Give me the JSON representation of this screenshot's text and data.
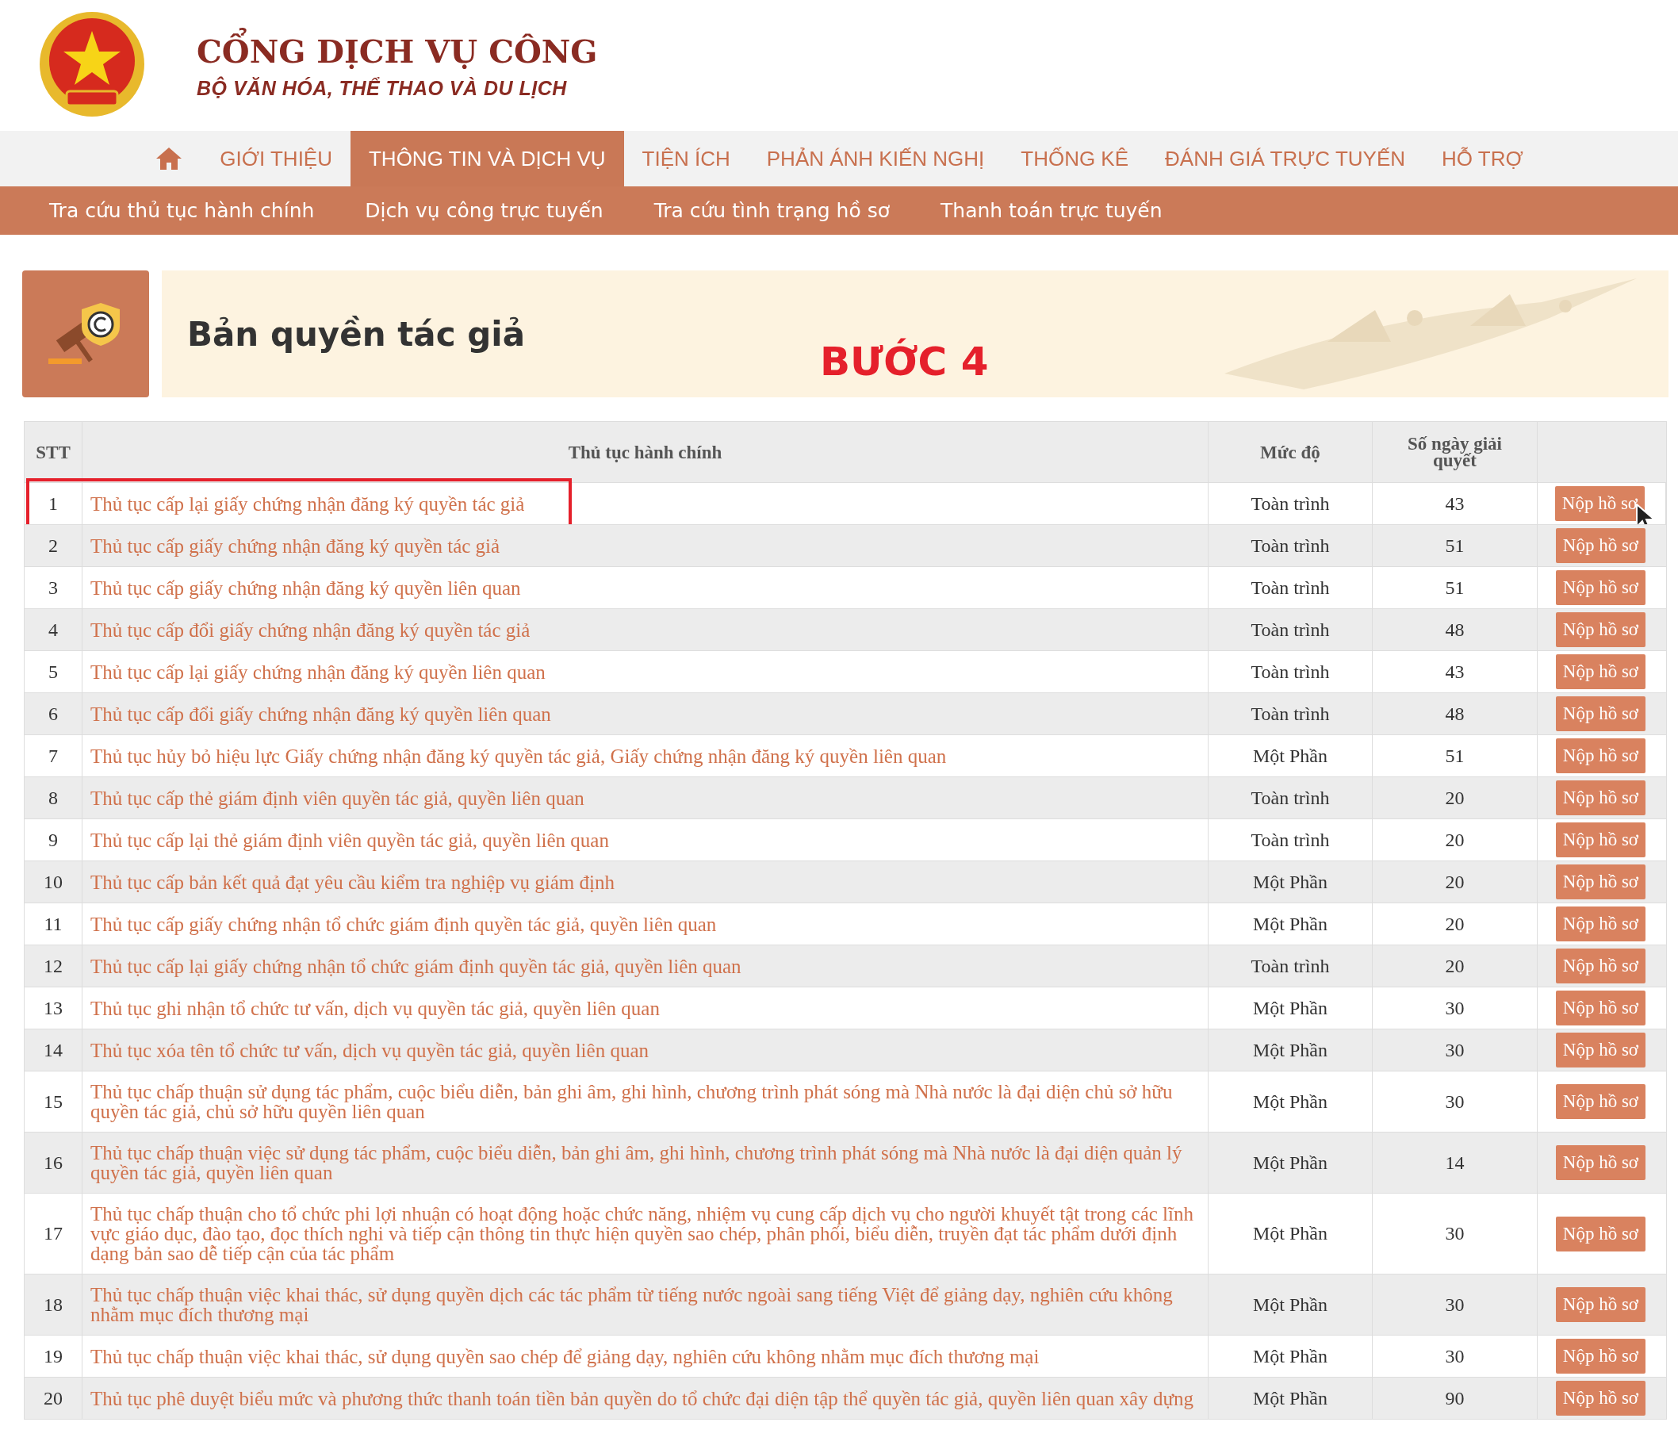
{
  "header": {
    "title": "CỔNG DỊCH VỤ CÔNG",
    "subtitle": "BỘ VĂN HÓA, THỂ THAO VÀ DU LỊCH"
  },
  "nav": [
    {
      "kind": "home",
      "selected": false
    },
    {
      "kind": "text",
      "label": "GIỚI THIỆU",
      "selected": false
    },
    {
      "kind": "text",
      "label": "THÔNG TIN VÀ DỊCH VỤ",
      "selected": true
    },
    {
      "kind": "text",
      "label": "TIỆN ÍCH",
      "selected": false
    },
    {
      "kind": "text",
      "label": "PHẢN ÁNH KIẾN NGHỊ",
      "selected": false
    },
    {
      "kind": "text",
      "label": "THỐNG KÊ",
      "selected": false
    },
    {
      "kind": "text",
      "label": "ĐÁNH GIÁ TRỰC TUYẾN",
      "selected": false
    },
    {
      "kind": "text",
      "label": "HỖ TRỢ",
      "selected": false
    }
  ],
  "subnav": [
    "Tra cứu thủ tục hành chính",
    "Dịch vụ công trực tuyến",
    "Tra cứu tình trạng hồ sơ",
    "Thanh toán trực tuyến"
  ],
  "banner": {
    "title": "Bản quyền tác giả",
    "annotation": "BƯỚC 4"
  },
  "table": {
    "columns": [
      "STT",
      "Thủ tục hành chính",
      "Mức độ",
      "Số ngày giải quyết"
    ],
    "rows": [
      {
        "stt": "1",
        "name": "Thủ tục cấp lại giấy chứng nhận đăng ký quyền tác giả",
        "level": "Toàn trình",
        "days": "43",
        "action": "Nộp hồ sơ",
        "highlighted": true,
        "hovered": true
      },
      {
        "stt": "2",
        "name": "Thủ tục cấp giấy chứng nhận đăng ký quyền tác giả",
        "level": "Toàn trình",
        "days": "51",
        "action": "Nộp hồ sơ",
        "highlighted": false,
        "hovered": false
      },
      {
        "stt": "3",
        "name": "Thủ tục cấp giấy chứng nhận đăng ký quyền liên quan",
        "level": "Toàn trình",
        "days": "51",
        "action": "Nộp hồ sơ",
        "highlighted": false,
        "hovered": false
      },
      {
        "stt": "4",
        "name": "Thủ tục cấp đổi giấy chứng nhận đăng ký quyền tác giả",
        "level": "Toàn trình",
        "days": "48",
        "action": "Nộp hồ sơ",
        "highlighted": false,
        "hovered": false
      },
      {
        "stt": "5",
        "name": "Thủ tục cấp lại giấy chứng nhận đăng ký quyền liên quan",
        "level": "Toàn trình",
        "days": "43",
        "action": "Nộp hồ sơ",
        "highlighted": false,
        "hovered": false
      },
      {
        "stt": "6",
        "name": "Thủ tục cấp đổi giấy chứng nhận đăng ký quyền liên quan",
        "level": "Toàn trình",
        "days": "48",
        "action": "Nộp hồ sơ",
        "highlighted": false,
        "hovered": false
      },
      {
        "stt": "7",
        "name": "Thủ tục hủy bỏ hiệu lực Giấy chứng nhận đăng ký quyền tác giả, Giấy chứng nhận đăng ký quyền liên quan",
        "level": "Một Phần",
        "days": "51",
        "action": "Nộp hồ sơ",
        "highlighted": false,
        "hovered": false
      },
      {
        "stt": "8",
        "name": "Thủ tục cấp thẻ giám định viên quyền tác giả, quyền liên quan",
        "level": "Toàn trình",
        "days": "20",
        "action": "Nộp hồ sơ",
        "highlighted": false,
        "hovered": false
      },
      {
        "stt": "9",
        "name": "Thủ tục cấp lại thẻ giám định viên quyền tác giả, quyền liên quan",
        "level": "Toàn trình",
        "days": "20",
        "action": "Nộp hồ sơ",
        "highlighted": false,
        "hovered": false
      },
      {
        "stt": "10",
        "name": "Thủ tục cấp bản kết quả đạt yêu cầu kiểm tra nghiệp vụ giám định",
        "level": "Một Phần",
        "days": "20",
        "action": "Nộp hồ sơ",
        "highlighted": false,
        "hovered": false
      },
      {
        "stt": "11",
        "name": "Thủ tục cấp giấy chứng nhận tổ chức giám định quyền tác giả, quyền liên quan",
        "level": "Một Phần",
        "days": "20",
        "action": "Nộp hồ sơ",
        "highlighted": false,
        "hovered": false
      },
      {
        "stt": "12",
        "name": "Thủ tục cấp lại giấy chứng nhận tổ chức giám định quyền tác giả, quyền liên quan",
        "level": "Toàn trình",
        "days": "20",
        "action": "Nộp hồ sơ",
        "highlighted": false,
        "hovered": false
      },
      {
        "stt": "13",
        "name": "Thủ tục ghi nhận tổ chức tư vấn, dịch vụ quyền tác giả, quyền liên quan",
        "level": "Một Phần",
        "days": "30",
        "action": "Nộp hồ sơ",
        "highlighted": false,
        "hovered": false
      },
      {
        "stt": "14",
        "name": "Thủ tục xóa tên tổ chức tư vấn, dịch vụ quyền tác giả, quyền liên quan",
        "level": "Một Phần",
        "days": "30",
        "action": "Nộp hồ sơ",
        "highlighted": false,
        "hovered": false
      },
      {
        "stt": "15",
        "name": "Thủ tục chấp thuận sử dụng tác phẩm, cuộc biểu diễn, bản ghi âm, ghi hình, chương trình phát sóng mà Nhà nước là đại diện chủ sở hữu quyền tác giả, chủ sở hữu quyền liên quan",
        "level": "Một Phần",
        "days": "30",
        "action": "Nộp hồ sơ",
        "highlighted": false,
        "hovered": false
      },
      {
        "stt": "16",
        "name": "Thủ tục chấp thuận việc sử dụng tác phẩm, cuộc biểu diễn, bản ghi âm, ghi hình, chương trình phát sóng mà Nhà nước là đại diện quản lý quyền tác giả, quyền liên quan",
        "level": "Một Phần",
        "days": "14",
        "action": "Nộp hồ sơ",
        "highlighted": false,
        "hovered": false
      },
      {
        "stt": "17",
        "name": "Thủ tục chấp thuận cho tổ chức phi lợi nhuận có hoạt động hoặc chức năng, nhiệm vụ cung cấp dịch vụ cho người khuyết tật trong các lĩnh vực giáo dục, đào tạo, đọc thích nghi và tiếp cận thông tin thực hiện quyền sao chép, phân phối, biểu diễn, truyền đạt tác phẩm dưới định dạng bản sao dễ tiếp cận của tác phẩm",
        "level": "Một Phần",
        "days": "30",
        "action": "Nộp hồ sơ",
        "highlighted": false,
        "hovered": false
      },
      {
        "stt": "18",
        "name": "Thủ tục chấp thuận việc khai thác, sử dụng quyền dịch các tác phẩm từ tiếng nước ngoài sang tiếng Việt để giảng dạy, nghiên cứu không nhằm mục đích thương mại",
        "level": "Một Phần",
        "days": "30",
        "action": "Nộp hồ sơ",
        "highlighted": false,
        "hovered": false
      },
      {
        "stt": "19",
        "name": "Thủ tục chấp thuận việc khai thác, sử dụng quyền sao chép để giảng dạy, nghiên cứu không nhằm mục đích thương mại",
        "level": "Một Phần",
        "days": "30",
        "action": "Nộp hồ sơ",
        "highlighted": false,
        "hovered": false
      },
      {
        "stt": "20",
        "name": "Thủ tục phê duyệt biểu mức và phương thức thanh toán tiền bản quyền do tổ chức đại diện tập thể quyền tác giả, quyền liên quan xây dựng",
        "level": "Một Phần",
        "days": "90",
        "action": "Nộp hồ sơ",
        "highlighted": false,
        "hovered": false
      }
    ]
  }
}
